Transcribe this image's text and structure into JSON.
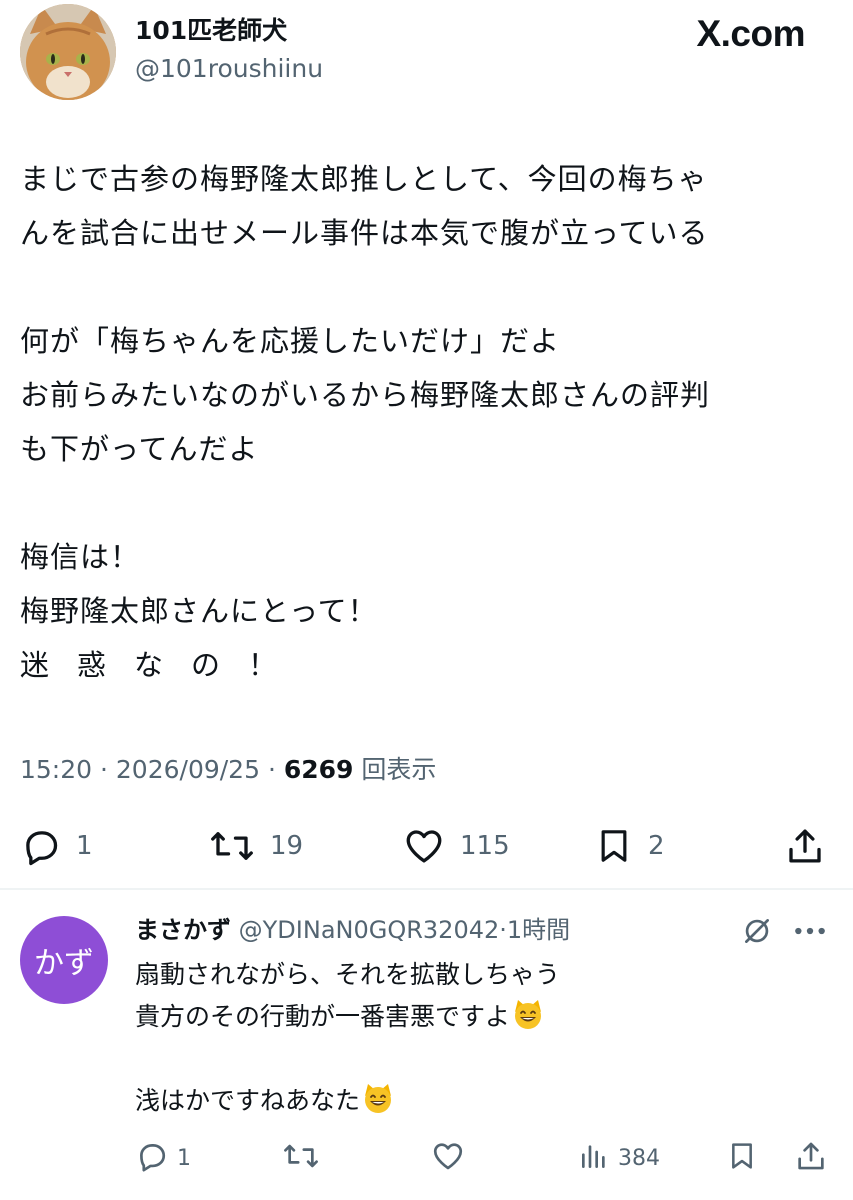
{
  "post": {
    "author": {
      "display_name": "101匹老師犬",
      "handle": "@101roushiinu",
      "avatar": "cat-photo"
    },
    "brand": "X.com",
    "body_lines": [
      "まじで古参の梅野隆太郎推しとして、今回の梅ちゃ",
      "んを試合に出せメール事件は本気で腹が立っている",
      "",
      "何が「梅ちゃんを応援したいだけ」だよ",
      "お前らみたいなのがいるから梅野隆太郎さんの評判",
      "も下がってんだよ",
      "",
      "梅信は！",
      "梅野隆太郎さんにとって！",
      "迷惑なの！"
    ],
    "time": "15:20",
    "date": "2026/09/25",
    "views": "6269",
    "views_label": "回表示",
    "stats": {
      "replies": "1",
      "reposts": "19",
      "likes": "115",
      "bookmarks": "2"
    },
    "icons": [
      "reply-icon",
      "repost-icon",
      "like-icon",
      "bookmark-icon",
      "share-icon"
    ]
  },
  "reply": {
    "avatar_text": "かず",
    "avatar_color": "#8e4ed6",
    "display_name": "まさかず",
    "handle": "@YDINaN0GQR32042",
    "time": "1時間",
    "body_lines": [
      "扇動されながら、それを拡散しちゃう",
      "貴方のその行動が一番害悪ですよ",
      "",
      "浅はかですねあなた"
    ],
    "emoji": "grinning-cat-emoji",
    "stats": {
      "replies": "1",
      "views": "384"
    },
    "icons": [
      "reply-icon",
      "repost-icon",
      "like-icon",
      "views-icon",
      "bookmark-icon",
      "share-icon",
      "mute-icon",
      "more-icon"
    ]
  },
  "colors": {
    "text": "#0f1419",
    "secondary": "#536471",
    "divider": "#eff3f4"
  }
}
